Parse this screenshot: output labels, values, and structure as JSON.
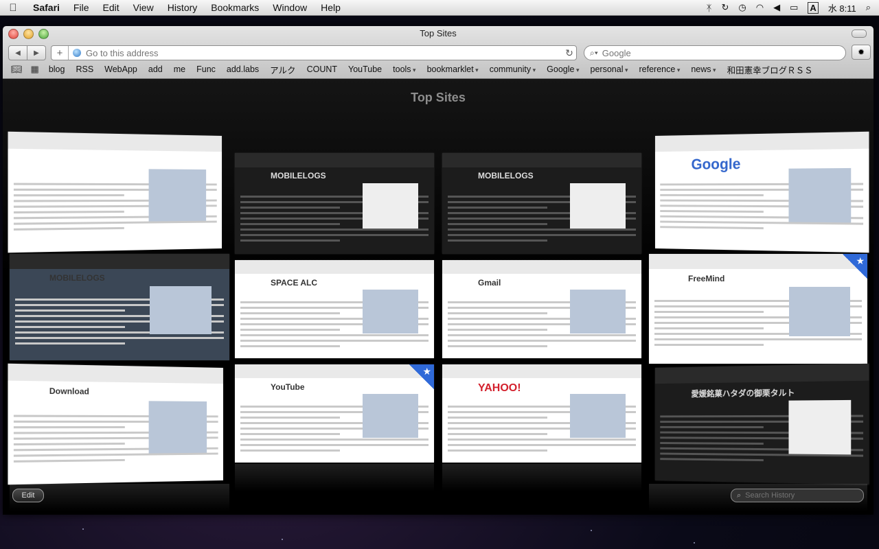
{
  "menubar": {
    "apple": "",
    "app": "Safari",
    "items": [
      "File",
      "Edit",
      "View",
      "History",
      "Bookmarks",
      "Window",
      "Help"
    ],
    "status_icons": [
      "bluetooth-icon",
      "sync-icon",
      "time-machine-icon",
      "wifi-icon",
      "volume-icon",
      "battery-icon",
      "input-method-icon"
    ],
    "input_method": "A",
    "clock": "水 8:11"
  },
  "window": {
    "title": "Top Sites"
  },
  "toolbar": {
    "address_placeholder": "Go to this address",
    "search_placeholder": "Google"
  },
  "bookmarks": [
    {
      "label": "blog",
      "menu": false
    },
    {
      "label": "RSS",
      "menu": false
    },
    {
      "label": "WebApp",
      "menu": false
    },
    {
      "label": "add",
      "menu": false
    },
    {
      "label": "me",
      "menu": false
    },
    {
      "label": "Func",
      "menu": false
    },
    {
      "label": "add.labs",
      "menu": false
    },
    {
      "label": "アルク",
      "menu": false
    },
    {
      "label": "COUNT",
      "menu": false
    },
    {
      "label": "YouTube",
      "menu": false
    },
    {
      "label": "tools",
      "menu": true
    },
    {
      "label": "bookmarklet",
      "menu": true
    },
    {
      "label": "community",
      "menu": true
    },
    {
      "label": "Google",
      "menu": true
    },
    {
      "label": "personal",
      "menu": true
    },
    {
      "label": "reference",
      "menu": true
    },
    {
      "label": "news",
      "menu": true
    },
    {
      "label": "和田憲幸ブログＲＳＳ",
      "menu": false
    }
  ],
  "top_sites": {
    "heading": "Top Sites",
    "edit_label": "Edit",
    "history_search_placeholder": "Search History",
    "tiles": [
      {
        "name": "apple-site",
        "headline": ""
      },
      {
        "name": "mobilelogs-1",
        "headline": "MOBILELOGS"
      },
      {
        "name": "mobilelogs-2",
        "headline": "MOBILELOGS"
      },
      {
        "name": "google",
        "headline": "Google"
      },
      {
        "name": "mobilelogs-3",
        "headline": "MOBILELOGS"
      },
      {
        "name": "space-alc",
        "headline": "SPACE ALC"
      },
      {
        "name": "gmail",
        "headline": "Gmail"
      },
      {
        "name": "freemind-wiki",
        "headline": "FreeMind"
      },
      {
        "name": "freemind-download",
        "headline": "Download"
      },
      {
        "name": "youtube",
        "headline": "YouTube"
      },
      {
        "name": "yahoo",
        "headline": "YAHOO!"
      },
      {
        "name": "hatada-tart",
        "headline": "愛媛銘菓ハタダの御栗タルト"
      }
    ]
  }
}
